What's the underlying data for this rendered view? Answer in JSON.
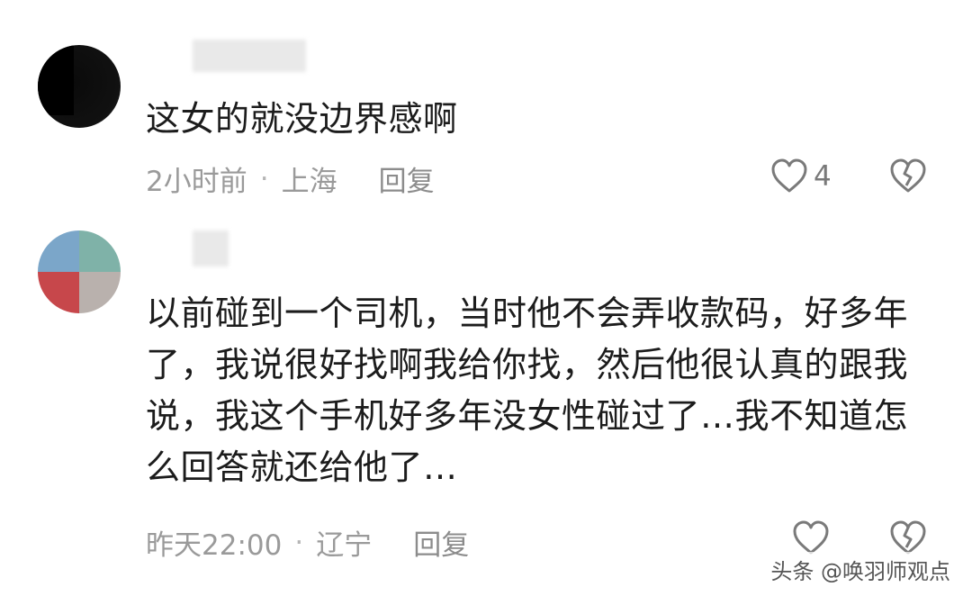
{
  "comments": [
    {
      "text": "这女的就没边界感啊",
      "time": "2小时前",
      "location": "上海",
      "reply_label": "回复",
      "like_count": "4",
      "icons": [
        "heart-outline-icon",
        "broken-heart-icon"
      ]
    },
    {
      "lines": [
        "以前碰到一个司机，当时他不会弄收款码，好多年",
        "了，我说很好找啊我给你找，然后他很认真的跟我",
        "说，我这个手机好多年没女性碰过了…我不知道怎",
        "么回答就还给他了…"
      ],
      "time": "昨天22:00",
      "location": "辽宁",
      "reply_label": "回复",
      "like_count": "",
      "icons": [
        "heart-outline-icon",
        "broken-heart-icon"
      ]
    }
  ],
  "separator": "·",
  "watermark": "头条 @唤羽师观点",
  "colors": {
    "text": "#1c1c1c",
    "meta": "#9a9a9a",
    "icon": "#7a7a7a"
  }
}
